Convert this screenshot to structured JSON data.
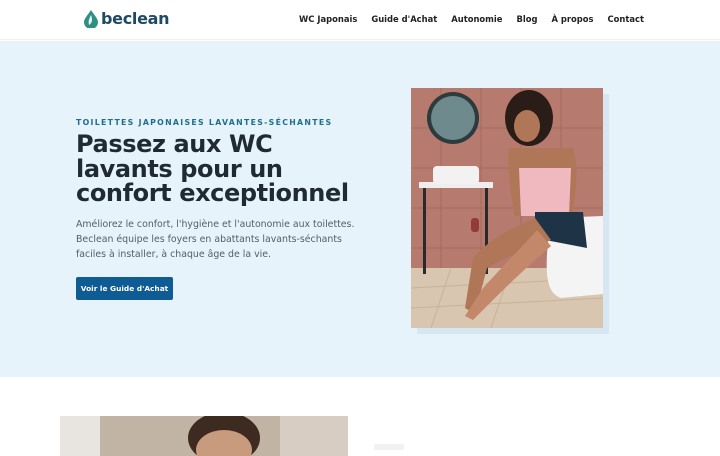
{
  "brand": {
    "name": "beclean",
    "logo_icon": "water-drop-leaf-icon",
    "accent_color": "#2e8f85",
    "text_color": "#1e4a63"
  },
  "nav": {
    "items": [
      {
        "label": "WC Japonais"
      },
      {
        "label": "Guide d'Achat"
      },
      {
        "label": "Autonomie"
      },
      {
        "label": "Blog"
      },
      {
        "label": "À propos"
      },
      {
        "label": "Contact"
      }
    ]
  },
  "hero": {
    "eyebrow": "TOILETTES JAPONAISES LAVANTES-SÉCHANTES",
    "title": "Passez aux WC lavants pour un confort exceptionnel",
    "description": "Améliorez le confort, l'hygiène et l'autonomie aux toilettes. Beclean équipe les foyers en abattants lavants-séchants faciles à installer, à chaque âge de la vie.",
    "cta_label": "Voir le Guide d'Achat",
    "background_color": "#e6f3fb",
    "button_color": "#0f5c95"
  }
}
